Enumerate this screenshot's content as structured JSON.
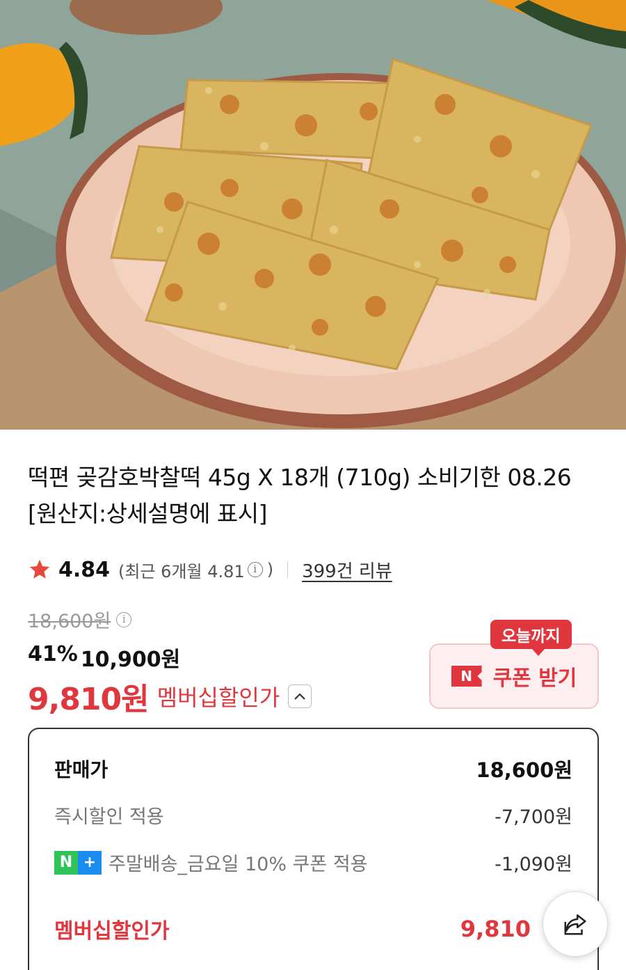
{
  "product": {
    "title": "떡편 곶감호박찰떡 45g X 18개 (710g) 소비기한 08.26 [원산지:상세설명에 표시]",
    "image_alt": "pumpkin persimmon rice cake on a plate"
  },
  "rating": {
    "score": "4.84",
    "recent_prefix": "(최근 6개월 4.81",
    "recent_suffix": ")",
    "info_glyph": "i",
    "review_count": "399건 리뷰"
  },
  "pricing": {
    "original_price": "18,600원",
    "discount_percent": "41%",
    "sale_price": "10,900원",
    "member_price": "9,810원",
    "member_label": "멤버십할인가"
  },
  "coupon": {
    "tag": "오늘까지",
    "badge": "N",
    "label": "쿠폰 받기"
  },
  "breakdown": {
    "rows": [
      {
        "label": "판매가",
        "value": "18,600원"
      },
      {
        "label": "즉시할인 적용",
        "value": "-7,700원"
      },
      {
        "label": "주말배송_금요일 10% 쿠폰 적용",
        "value": "-1,090원"
      },
      {
        "label": "멤버십할인가",
        "value": "9,810"
      }
    ],
    "nplus_n": "N",
    "nplus_plus": "+"
  },
  "colors": {
    "accent_red": "#e0373f",
    "star": "#e8473b",
    "nplus_green": "#2fc35a",
    "nplus_blue": "#1a8cf0"
  },
  "icons": {
    "star": "star-icon",
    "info": "info-icon",
    "chevron": "chevron-up-icon",
    "share": "share-icon",
    "coupon_badge": "n-badge-icon",
    "nplus": "nplus-icon"
  }
}
